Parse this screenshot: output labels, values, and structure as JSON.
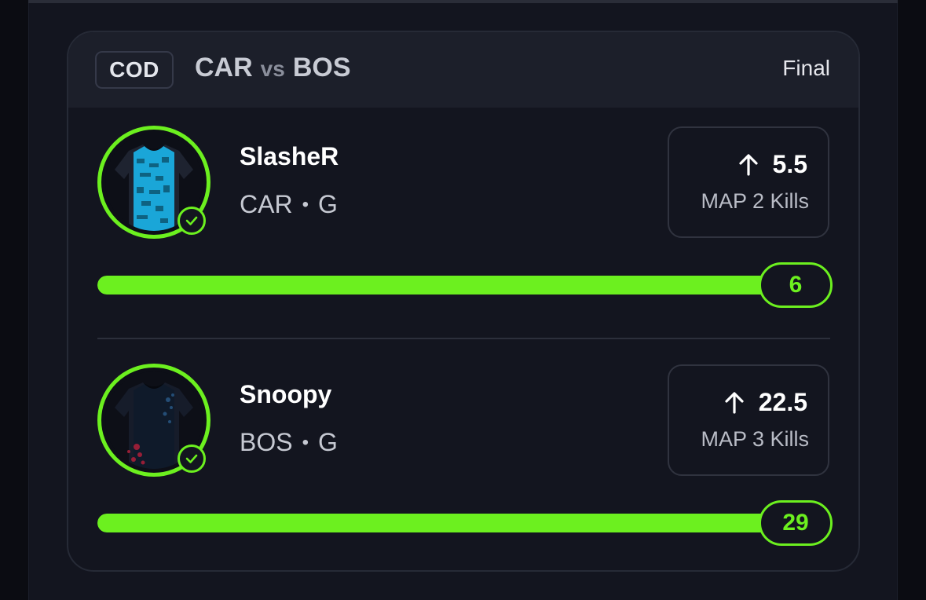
{
  "header": {
    "sport": "COD",
    "team_a": "CAR",
    "vs": "vs",
    "team_b": "BOS",
    "status": "Final"
  },
  "players": [
    {
      "name": "SlasheR",
      "team": "CAR",
      "separator": "•",
      "position": "G",
      "line": "5.5",
      "direction_icon": "arrow-up-icon",
      "stat": "MAP 2 Kills",
      "result": "6",
      "progress_fraction": 1.0,
      "jersey_color": "#1aa6d8"
    },
    {
      "name": "Snoopy",
      "team": "BOS",
      "separator": "•",
      "position": "G",
      "line": "22.5",
      "direction_icon": "arrow-up-icon",
      "stat": "MAP 3 Kills",
      "result": "29",
      "progress_fraction": 1.0,
      "jersey_color": "#0f1a2a"
    }
  ],
  "colors": {
    "accent": "#6cf01f",
    "background": "#13151f",
    "header_bg": "#1c1f2a"
  }
}
